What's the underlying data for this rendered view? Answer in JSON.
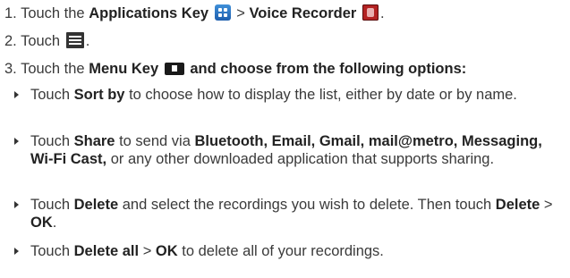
{
  "step1": {
    "number": "1.",
    "touch": "Touch the",
    "apps_key": "Applications Key",
    "sep": ">",
    "voice_recorder": "Voice Recorder",
    "end": ".",
    "apps_icon": "applications-grid-icon",
    "recorder_icon": "voice-recorder-icon"
  },
  "step2": {
    "number": "2.",
    "touch": "Touch",
    "end": ".",
    "list_icon": "list-icon"
  },
  "step3": {
    "number": "3.",
    "touch": "Touch the",
    "menu_key": "Menu Key",
    "rest": "and choose from the following options:",
    "menu_icon": "menu-key-icon"
  },
  "bullets": [
    {
      "pre": "Touch",
      "bold": "Sort by",
      "post": "to choose how to display the list, either by date or by name."
    },
    {
      "pre": "Touch",
      "bold": "Share",
      "mid": "to send via",
      "bold2": "Bluetooth, Email, Gmail, mail@metro, Messaging, Wi-Fi Cast,",
      "post": "or any other downloaded application that supports sharing."
    },
    {
      "pre": "Touch",
      "bold": "Delete",
      "mid": "and select the recordings you wish to delete. Then touch",
      "bold2": "Delete",
      "sep": ">",
      "bold3": "OK",
      "end": "."
    },
    {
      "pre": "Touch",
      "bold": "Delete all",
      "sep": ">",
      "bold2": "OK",
      "post": "to delete all of your recordings."
    }
  ],
  "colors": {
    "text": "#3a3a3a",
    "bold_text": "#222222",
    "apps_icon": "#2f78c8",
    "recorder_icon": "#b32222"
  }
}
